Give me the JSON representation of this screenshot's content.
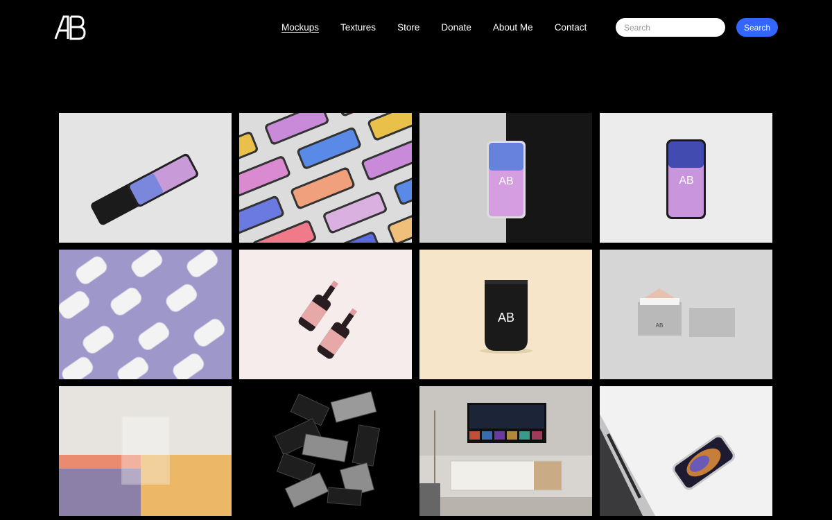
{
  "brand": {
    "logo_text": "AB"
  },
  "nav": {
    "items": [
      {
        "label": "Mockups",
        "active": true
      },
      {
        "label": "Textures",
        "active": false
      },
      {
        "label": "Store",
        "active": false
      },
      {
        "label": "Donate",
        "active": false
      },
      {
        "label": "About Me",
        "active": false
      },
      {
        "label": "Contact",
        "active": false
      }
    ]
  },
  "search": {
    "placeholder": "Search",
    "value": "",
    "button_label": "Search"
  },
  "colors": {
    "background": "#000000",
    "accent": "#3366ff"
  },
  "gallery": {
    "items": [
      {
        "name": "phone-pair-mockup"
      },
      {
        "name": "phone-pattern-mockup"
      },
      {
        "name": "phone-split-mockup"
      },
      {
        "name": "phone-single-mockup"
      },
      {
        "name": "can-pattern-mockup"
      },
      {
        "name": "wine-bottle-mockup"
      },
      {
        "name": "coffee-pouch-mockup"
      },
      {
        "name": "envelope-card-mockup"
      },
      {
        "name": "book-cover-mockup"
      },
      {
        "name": "business-cards-mockup"
      },
      {
        "name": "tv-screen-mockup"
      },
      {
        "name": "laptop-phone-mockup"
      }
    ]
  }
}
